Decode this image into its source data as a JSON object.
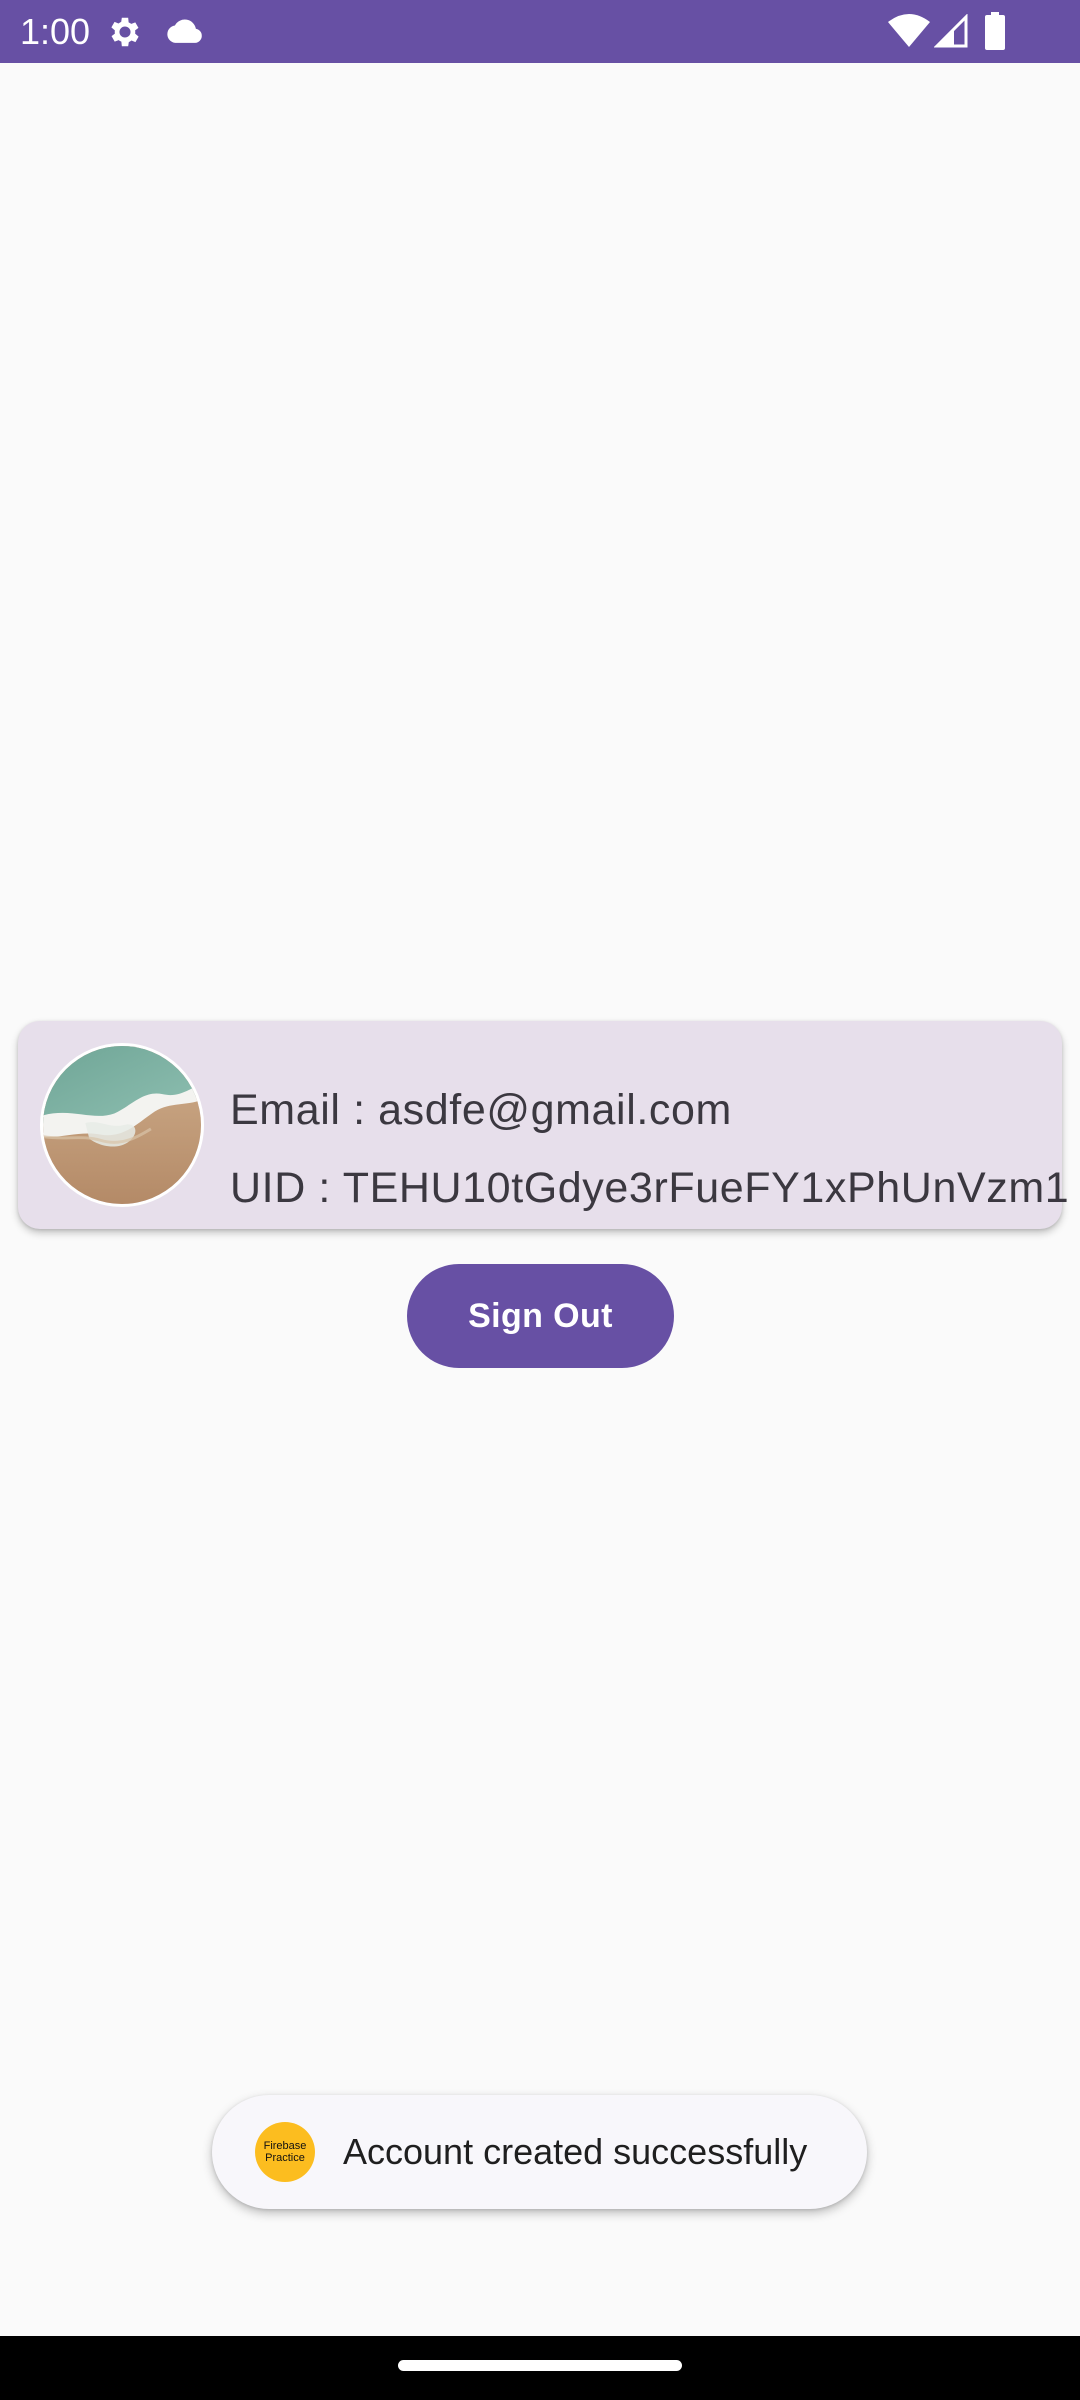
{
  "status_bar": {
    "time": "1:00",
    "background_color": "#6750a4",
    "icons": [
      "gear-icon",
      "cloud-icon",
      "wifi-icon",
      "signal-icon",
      "battery-icon"
    ]
  },
  "profile_card": {
    "email_label": "Email : ",
    "email_value": "asdfe@gmail.com",
    "uid_label": "UID : ",
    "uid_value": "TEHU10tGdye3rFueFY1xPhUnVzm1",
    "background_color": "#e7dfeb"
  },
  "sign_out_button": {
    "label": "Sign Out",
    "color": "#6750a4"
  },
  "toast": {
    "app_icon_line1": "Firebase",
    "app_icon_line2": "Practice",
    "app_icon_color": "#fcbd1f",
    "message": "Account created successfully"
  }
}
